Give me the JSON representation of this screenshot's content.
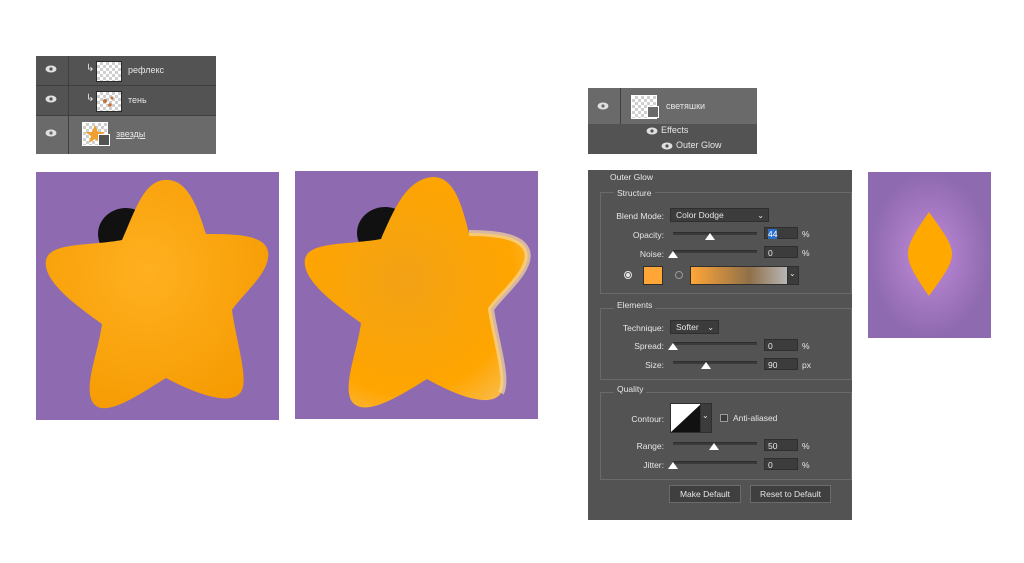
{
  "layers_panel_left": {
    "layers": [
      {
        "name": "рефлекс"
      },
      {
        "name": "тень"
      },
      {
        "name": "звезды"
      }
    ]
  },
  "layers_panel_right": {
    "layer_name": "светяшки",
    "effects_label": "Effects",
    "effect_name": "Outer Glow"
  },
  "outer_glow": {
    "title": "Outer Glow",
    "structure": {
      "title": "Structure",
      "blend_mode_label": "Blend Mode:",
      "blend_mode_value": "Color Dodge",
      "opacity_label": "Opacity:",
      "opacity_value": "44",
      "opacity_unit": "%",
      "opacity_level": 0.44,
      "noise_label": "Noise:",
      "noise_value": "0",
      "noise_unit": "%",
      "glow_color": "#ffa637"
    },
    "elements": {
      "title": "Elements",
      "technique_label": "Technique:",
      "technique_value": "Softer",
      "spread_label": "Spread:",
      "spread_value": "0",
      "spread_unit": "%",
      "size_label": "Size:",
      "size_value": "90",
      "size_unit": "px"
    },
    "quality": {
      "title": "Quality",
      "contour_label": "Contour:",
      "anti_aliased_label": "Anti-aliased",
      "range_label": "Range:",
      "range_value": "50",
      "range_unit": "%",
      "jitter_label": "Jitter:",
      "jitter_value": "0",
      "jitter_unit": "%"
    },
    "make_default_label": "Make Default",
    "reset_default_label": "Reset to Default"
  },
  "colors": {
    "star": "#ffa500",
    "background_purple": "#8e6ab0",
    "panel": "#535353"
  }
}
